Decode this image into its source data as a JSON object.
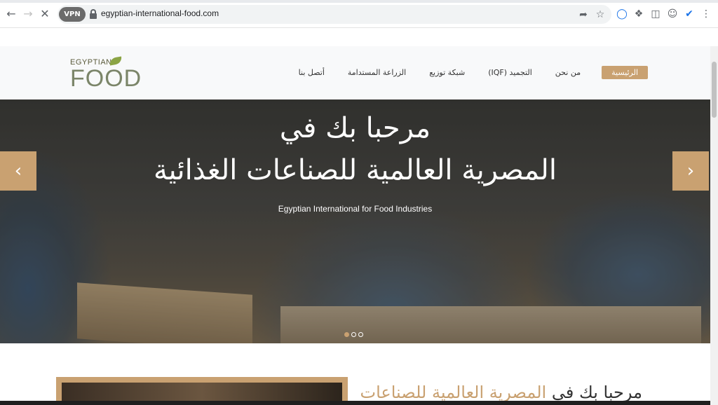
{
  "browser": {
    "vpn_label": "VPN",
    "url": "egyptian-international-food.com"
  },
  "logo": {
    "small": "EGYPTIAN",
    "big": "FOOD"
  },
  "nav": {
    "items": [
      {
        "label": "الرئيسية",
        "active": true
      },
      {
        "label": "من نحن"
      },
      {
        "label": "التجميد (IQF)"
      },
      {
        "label": "شبكة توزيع"
      },
      {
        "label": "الزراعة المستدامة"
      },
      {
        "label": "أتصل بنا"
      }
    ]
  },
  "hero": {
    "title_line1": "مرحبا بك في",
    "title_line2": "المصرية العالمية للصناعات الغذائية",
    "subtitle": "Egyptian International for Food Industries"
  },
  "about": {
    "title_plain": "مرحبا بك في",
    "title_highlight": "المصرية العالمية للصناعات"
  },
  "colors": {
    "accent": "#c9a171",
    "header_bg": "#f8f9fa"
  }
}
